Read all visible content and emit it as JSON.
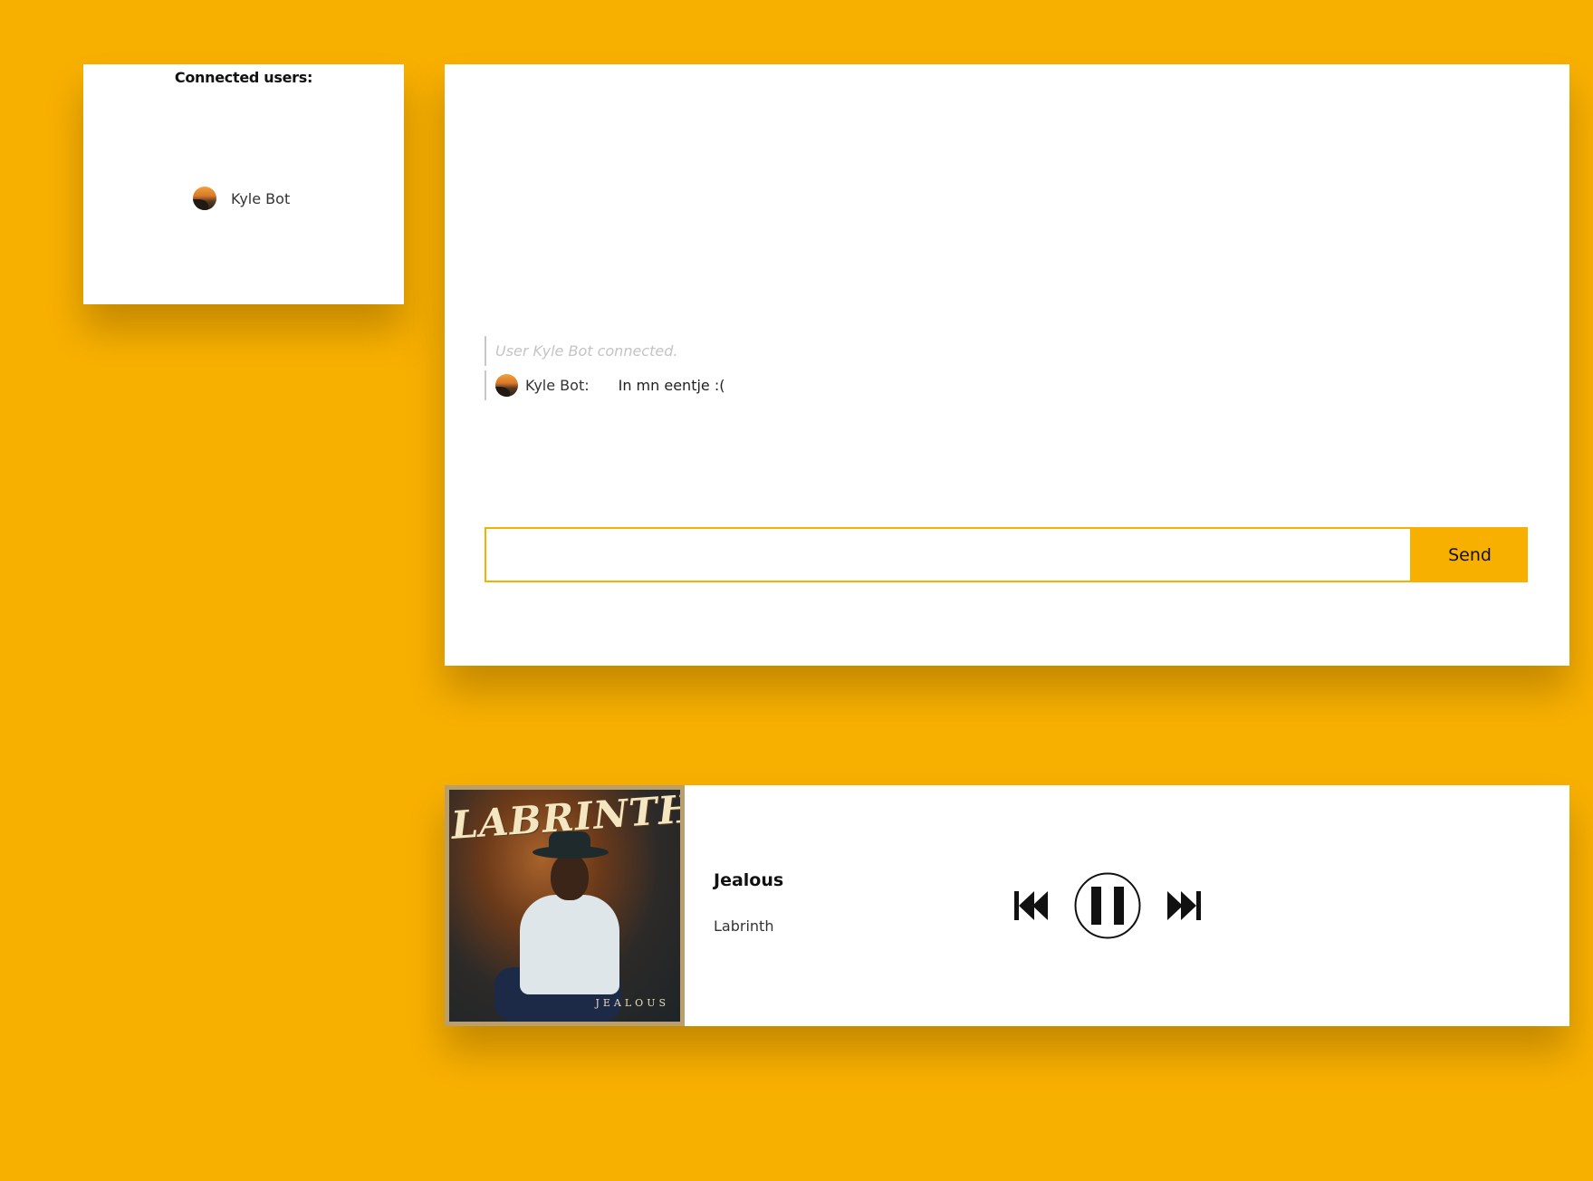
{
  "users_panel": {
    "title": "Connected users:",
    "users": [
      {
        "name": "Kyle Bot",
        "avatar_icon": "user-avatar-icon"
      }
    ]
  },
  "chat": {
    "messages": [
      {
        "type": "system",
        "text": "User Kyle Bot connected."
      },
      {
        "type": "user",
        "author": "Kyle Bot:",
        "text": "In mn eentje :("
      }
    ],
    "input": {
      "value": "",
      "placeholder": ""
    },
    "send_label": "Send"
  },
  "player": {
    "album_art": {
      "artist_text": "LABRINTH",
      "title_text": "JEALOUS"
    },
    "track_title": "Jealous",
    "track_artist": "Labrinth",
    "controls": [
      "previous-icon",
      "pause-icon",
      "next-icon"
    ]
  },
  "colors": {
    "background": "#f8b000",
    "accent": "#f8b000",
    "panel": "#ffffff"
  }
}
